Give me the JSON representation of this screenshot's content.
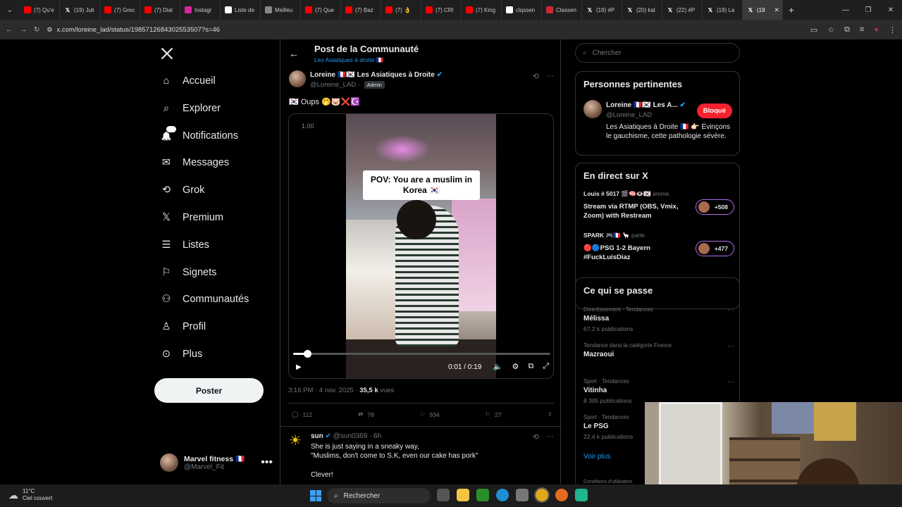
{
  "browser": {
    "tabs": [
      {
        "label": "(7) Qu'e",
        "icon": "youtube-icon",
        "color": "#ff0000"
      },
      {
        "label": "(19) Juli",
        "icon": "x-icon",
        "color": "#000000"
      },
      {
        "label": "(7) Grec",
        "icon": "youtube-icon",
        "color": "#ff0000"
      },
      {
        "label": "(7) Dial",
        "icon": "youtube-icon",
        "color": "#ff0000"
      },
      {
        "label": "Instagr",
        "icon": "instagram-icon",
        "color": "#d6249f"
      },
      {
        "label": "Liste de",
        "icon": "wikipedia-icon",
        "color": "#ffffff"
      },
      {
        "label": "Meilleu",
        "icon": "chatgpt-icon",
        "color": "#888888"
      },
      {
        "label": "(7) Que",
        "icon": "youtube-icon",
        "color": "#ff0000"
      },
      {
        "label": "(7) Baz",
        "icon": "youtube-icon",
        "color": "#ff0000"
      },
      {
        "label": "(7) 👌",
        "icon": "youtube-icon",
        "color": "#ff0000"
      },
      {
        "label": "(7) CRI",
        "icon": "youtube-icon",
        "color": "#ff0000"
      },
      {
        "label": "(7) King",
        "icon": "youtube-icon",
        "color": "#ff0000"
      },
      {
        "label": "clqssen",
        "icon": "google-icon",
        "color": "#ffffff"
      },
      {
        "label": "Classen",
        "icon": "zotero-icon",
        "color": "#cc2936"
      },
      {
        "label": "(19) #P",
        "icon": "x-icon",
        "color": "#000000"
      },
      {
        "label": "(20) kal",
        "icon": "x-icon",
        "color": "#000000"
      },
      {
        "label": "(22) #P",
        "icon": "x-icon",
        "color": "#000000"
      },
      {
        "label": "(19) La",
        "icon": "x-icon",
        "color": "#000000"
      },
      {
        "label": "(19",
        "icon": "x-icon",
        "color": "#000000",
        "active": true
      }
    ],
    "url": "x.com/loreine_lad/status/1985712684302553507?s=46"
  },
  "nav": {
    "items": [
      {
        "label": "Accueil",
        "icon": "home-icon"
      },
      {
        "label": "Explorer",
        "icon": "search-icon"
      },
      {
        "label": "Notifications",
        "icon": "bell-icon",
        "badge": "19"
      },
      {
        "label": "Messages",
        "icon": "mail-icon"
      },
      {
        "label": "Grok",
        "icon": "grok-icon"
      },
      {
        "label": "Premium",
        "icon": "x-logo-icon"
      },
      {
        "label": "Listes",
        "icon": "list-icon"
      },
      {
        "label": "Signets",
        "icon": "bookmark-icon"
      },
      {
        "label": "Communautés",
        "icon": "communities-icon"
      },
      {
        "label": "Profil",
        "icon": "profile-icon"
      },
      {
        "label": "Plus",
        "icon": "more-circle-icon"
      }
    ],
    "post_button": "Poster",
    "account": {
      "name": "Marvel fitness 🇫🇷",
      "handle": "@Marvel_Fit"
    }
  },
  "header": {
    "title": "Post de la Communauté",
    "subtitle": "Les Asiatiques à droite 🇫🇷"
  },
  "tweet": {
    "author": "Loreine 🇫🇷🇰🇷 Les Asiatiques à Droite",
    "handle": "@Loreine_LAD",
    "role_badge": "Admin",
    "text": "🇰🇷 Oups 🤭🐷❌☪️",
    "video": {
      "speed": "1.00",
      "caption": "POV: You are a muslim in Korea 🇰🇷",
      "time": "0:01 / 0:19",
      "progress": 0.055
    },
    "timestamp": "3:16 PM · 4 nov. 2025 · ",
    "views_count": "35,5 k",
    "views_label": " vues",
    "replies": "112",
    "reposts": "78",
    "likes": "934",
    "bookmarks": "27"
  },
  "reply": {
    "name": "sun",
    "handle": "@sun0369 · 6h",
    "text_line1": "She is just saying in a sneaky way,",
    "text_line2": "\"Muslims, don't come to S.K, even our cake has pork\"",
    "text_line3": "Clever!"
  },
  "sidebar": {
    "search_placeholder": "Chercher",
    "relevant": {
      "title": "Personnes pertinentes",
      "name": "Loreine 🇫🇷🇰🇷 Les A...",
      "handle": "@Loreine_LAD",
      "button": "Bloqué",
      "bio": "Les Asiatiques à Droite 🇫🇷 👉🏻 Évinçons le gauchisme, cette pathologie sévère."
    },
    "live": {
      "title": "En direct sur X",
      "items": [
        {
          "host": "Louis # 5017 🎬🧠👁️🇰🇷",
          "host_action": " anime.",
          "title": "Stream via RTMP (OBS, Vmix, Zoom) with Restream",
          "count": "+508"
        },
        {
          "host": "SPARK 🎮🇫🇷 🦙",
          "host_action": " parle.",
          "title": "🔴🔵PSG 1-2 Bayern #FuckLuisDiaz",
          "count": "+477"
        }
      ]
    },
    "trends": {
      "title": "Ce qui se passe",
      "items": [
        {
          "category": "Divertissement · Tendances",
          "name": "Mélissa",
          "count": "67,2 k publications"
        },
        {
          "category": "Tendance dans la catégorie France",
          "name": "Mazraoui",
          "count": ""
        },
        {
          "category": "Sport · Tendances",
          "name": "Vitinha",
          "count": "8 305 publications"
        },
        {
          "category": "Sport · Tendances",
          "name": "Le PSG",
          "count": "22,4 k publications"
        }
      ],
      "see_more": "Voir plus",
      "footer": "Conditions d'utilisation"
    }
  },
  "taskbar": {
    "temp": "11°C",
    "weather": "Ciel couvert",
    "search": "Rechercher"
  }
}
